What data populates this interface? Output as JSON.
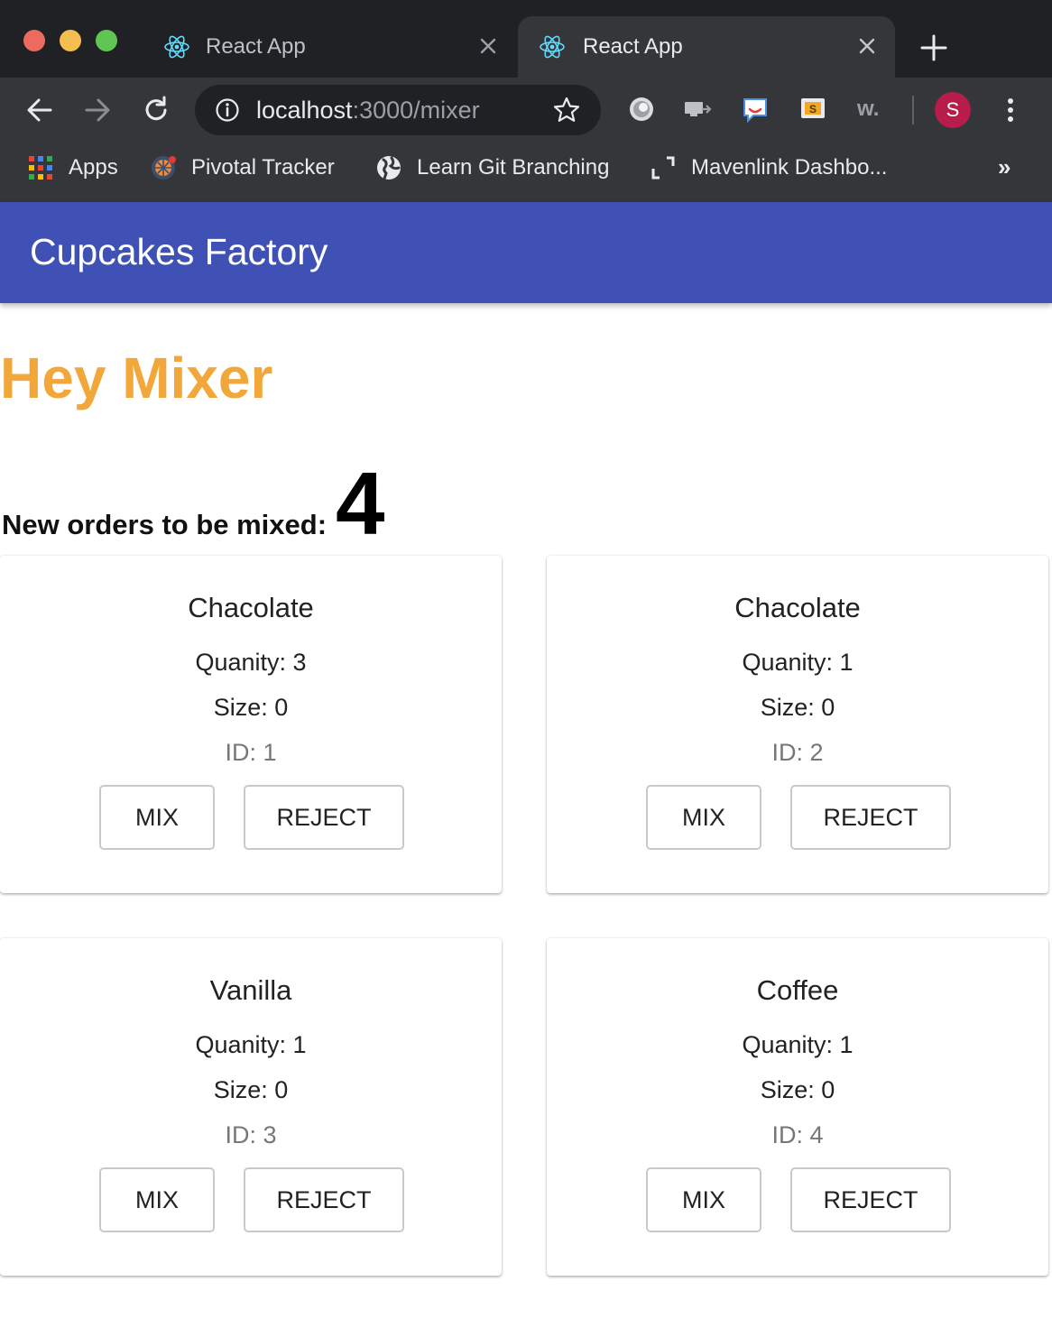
{
  "browser": {
    "tabs": [
      {
        "title": "React App",
        "active": false
      },
      {
        "title": "React App",
        "active": true
      }
    ],
    "url_host": "localhost",
    "url_path": ":3000/mixer",
    "profile_initial": "S",
    "bookmarks": [
      {
        "label": "Apps",
        "icon": "apps-grid-icon"
      },
      {
        "label": "Pivotal Tracker",
        "icon": "pivotal-tracker-icon"
      },
      {
        "label": "Learn Git Branching",
        "icon": "globe-icon"
      },
      {
        "label": "Mavenlink Dashbo...",
        "icon": "mavenlink-icon"
      }
    ],
    "bookmarks_more": "»",
    "extensions": [
      "circle-extension-icon",
      "cast-extension-icon",
      "chat-extension-icon",
      "sublime-extension-icon",
      "w-extension-icon"
    ],
    "colors": {
      "tabstrip": "#202124",
      "toolbar": "#35363a",
      "avatar": "#b71c4b"
    }
  },
  "app": {
    "title": "Cupcakes Factory",
    "heading": "Hey Mixer",
    "orders_label": "New orders to be mixed:",
    "orders_count": "4",
    "colors": {
      "appbar": "#3f51b5",
      "heading": "#f1a73a"
    },
    "cards": [
      {
        "flavor": "Chacolate",
        "quantity": "Quanity: 3",
        "size": "Size: 0",
        "id": "ID: 1",
        "mix_label": "MIX",
        "reject_label": "REJECT"
      },
      {
        "flavor": "Chacolate",
        "quantity": "Quanity: 1",
        "size": "Size: 0",
        "id": "ID: 2",
        "mix_label": "MIX",
        "reject_label": "REJECT"
      },
      {
        "flavor": "Vanilla",
        "quantity": "Quanity: 1",
        "size": "Size: 0",
        "id": "ID: 3",
        "mix_label": "MIX",
        "reject_label": "REJECT"
      },
      {
        "flavor": "Coffee",
        "quantity": "Quanity: 1",
        "size": "Size: 0",
        "id": "ID: 4",
        "mix_label": "MIX",
        "reject_label": "REJECT"
      }
    ]
  }
}
